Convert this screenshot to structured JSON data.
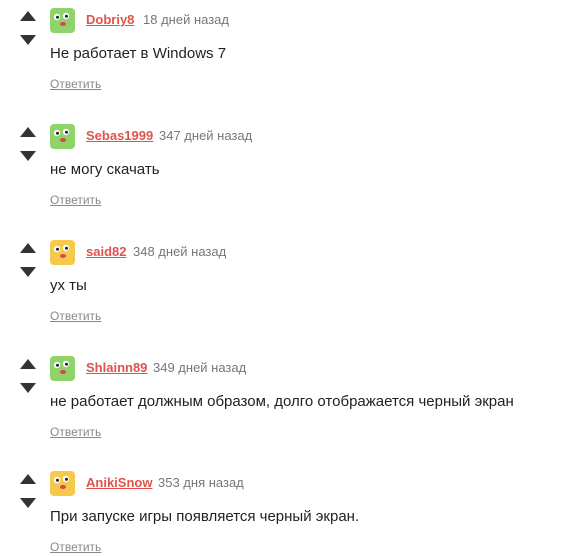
{
  "comments": [
    {
      "username": "Dobriy8",
      "time_ago": "18 дней назад",
      "text": "Не работает в Windows 7",
      "reply_label": "Ответить",
      "avatar_color": "#8fd46b",
      "avatar_icon": "green-smiley-avatar-icon"
    },
    {
      "username": "Sebas1999",
      "time_ago": "347 дней назад",
      "text": "не могу скачать",
      "reply_label": "Ответить",
      "avatar_color": "#8fd46b",
      "avatar_icon": "green-smiley-avatar-icon"
    },
    {
      "username": "said82",
      "time_ago": "348 дней назад",
      "text": "ух ты",
      "reply_label": "Ответить",
      "avatar_color": "#f7c94a",
      "avatar_icon": "yellow-smiley-avatar-icon"
    },
    {
      "username": "Shlainn89",
      "time_ago": "349 дней назад",
      "text": "не работает должным образом, долго отображается черный экран",
      "reply_label": "Ответить",
      "avatar_color": "#8fd46b",
      "avatar_icon": "green-smiley-avatar-icon"
    },
    {
      "username": "AnikiSnow",
      "time_ago": "353 дня назад",
      "text": "При запуске игры появляется черный экран.",
      "reply_label": "Ответить",
      "avatar_color": "#f7c94a",
      "avatar_icon": "yellow-smiley-avatar-icon"
    }
  ],
  "colors": {
    "username": "#e0534d",
    "timestamp": "#777777",
    "reply": "#888888",
    "text": "#222222",
    "arrows": "#333333"
  }
}
